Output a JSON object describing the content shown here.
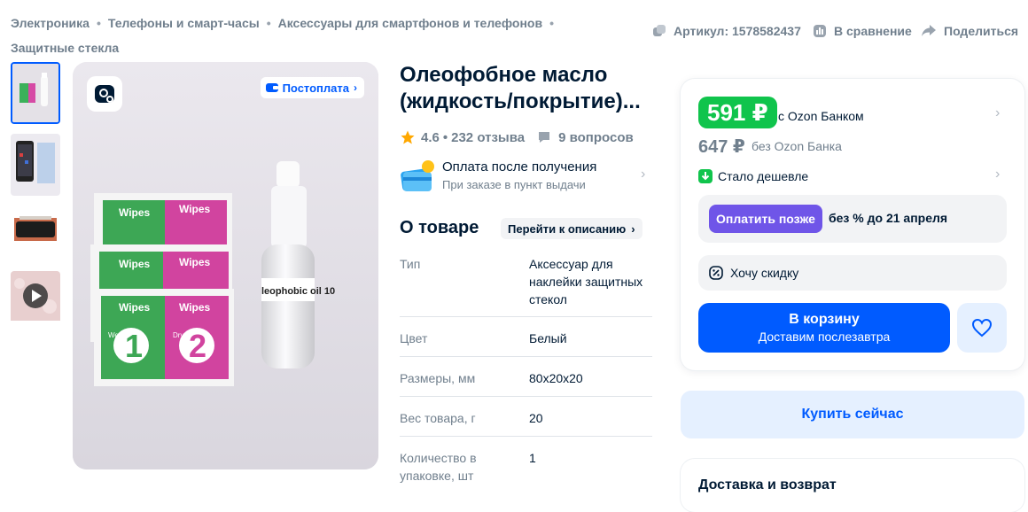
{
  "breadcrumbs": [
    "Электроника",
    "Телефоны и смарт-часы",
    "Аксессуары для смартфонов и телефонов",
    "Защитные стекла"
  ],
  "meta": {
    "article": "Артикул: 1578582437",
    "compare": "В сравнение",
    "share": "Поделиться"
  },
  "gallery": {
    "postpay_badge": "Постоплата",
    "wipes_label": "Wipes",
    "wet_number": "1",
    "dry_number": "2",
    "wet_label": "Wet",
    "dry_label": "Dry",
    "bottle_label": "leophobic oil 10"
  },
  "product": {
    "title": "Олеофобное масло (жидкость/покрытие)...",
    "rating": "4.6",
    "reviews": "232 отзыва",
    "questions": "9 вопросов",
    "pay_after_title": "Оплата после получения",
    "pay_after_subtitle": "При заказе в пункт выдачи"
  },
  "about": {
    "heading": "О товаре",
    "goto_description": "Перейти к описанию",
    "specs": [
      {
        "key": "Тип",
        "value": "Аксессуар для наклейки защитных стекол"
      },
      {
        "key": "Цвет",
        "value": "Белый"
      },
      {
        "key": "Размеры, мм",
        "value": "80x20x20"
      },
      {
        "key": "Вес товара, г",
        "value": "20"
      },
      {
        "key": "Количество в упаковке, шт",
        "value": "1"
      }
    ]
  },
  "price_card": {
    "price": "591 ₽",
    "bank_label": "с Ozon Банком",
    "old_price": "647 ₽",
    "nobank_label": "без Ozon Банка",
    "cheaper": "Стало дешевле",
    "pay_later_button": "Оплатить позже",
    "pay_later_text": "без % до 21 апреля",
    "want_discount": "Хочу скидку",
    "cart_button": "В корзину",
    "cart_subtitle": "Доставим послезавтра",
    "buy_now": "Купить сейчас",
    "delivery_title": "Доставка и возврат"
  },
  "colors": {
    "accent": "#005bff",
    "price_green": "#10c44c",
    "pay_later_purple": "#6f55e8",
    "star": "#ffa800"
  }
}
